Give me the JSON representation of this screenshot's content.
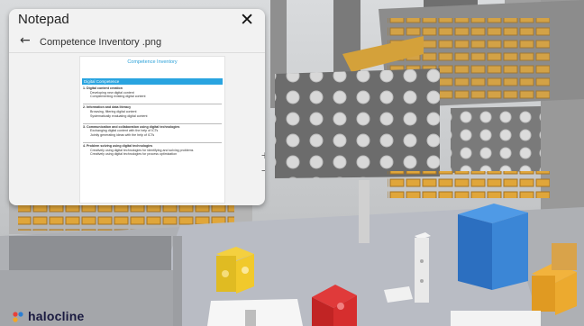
{
  "notepad": {
    "title": "Notepad",
    "close_icon": "close-icon",
    "back_icon": "back-arrow-icon",
    "file_name": "Competence Inventory .png",
    "zoom_in": "+",
    "zoom_out": "−"
  },
  "document": {
    "title": "Competence Inventory",
    "banner": "Digital Competence",
    "sections": [
      {
        "heading": "1. Digital content creation",
        "items": [
          "Developing new digital content",
          "Complementing existing digital content"
        ]
      },
      {
        "heading": "2. Information and data literacy",
        "items": [
          "Browsing, filtering digital content",
          "Systematically evaluating digital content"
        ]
      },
      {
        "heading": "3. Communication and collaboration using digital technologies",
        "items": [
          "Exchanging digital content with the help of ICTs",
          "Jointly generating ideas with the help of ICTs"
        ]
      },
      {
        "heading": "4. Problem solving using digital technologies",
        "items": [
          "Creatively using digital technologies for identifying and solving problems",
          "Creatively using digital technologies for process optimization"
        ]
      }
    ]
  },
  "brand": {
    "name": "halocline",
    "colors": {
      "mark_red": "#e8403a",
      "mark_blue": "#2a7fd4",
      "mark_orange": "#f5a623",
      "text": "#1a1a40"
    }
  }
}
